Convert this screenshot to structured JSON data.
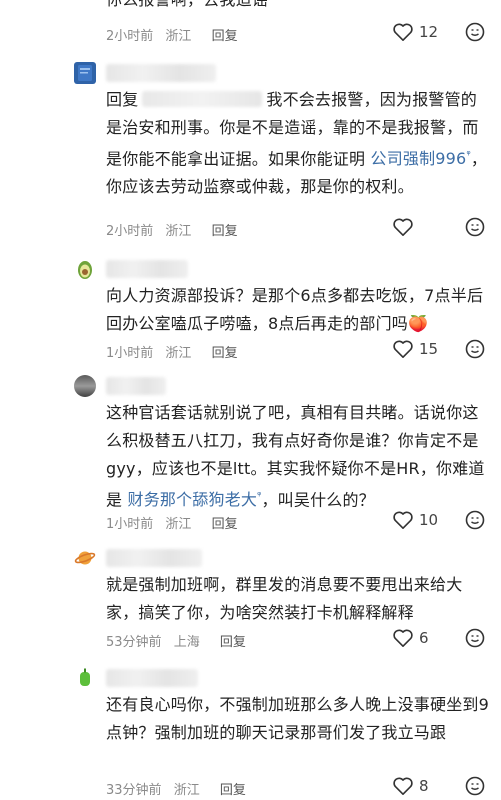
{
  "comments": [
    {
      "text": "你么报警啊，去我造谣",
      "time": "2小时前",
      "location": "浙江",
      "reply": "回复",
      "likes": "12"
    },
    {
      "text_prefix": "回复",
      "text_main": "我不会去报警，因为报警管的是治安和刑事。你是不是造谣，靠的不是我报警，而是你能不能拿出证据。如果你能证明",
      "link": "公司强制996",
      "link_mark": "ᵠ",
      "text_after": "，你应该去劳动监察或仲裁，那是你的权利。",
      "time": "2小时前",
      "location": "浙江",
      "reply": "回复",
      "likes": ""
    },
    {
      "text": "向人力资源部投诉？是那个6点多都去吃饭，7点半后回办公室嗑瓜子唠嗑，8点后再走的部门吗🍑",
      "time": "1小时前",
      "location": "浙江",
      "reply": "回复",
      "likes": "15"
    },
    {
      "text_main": "这种官话套话就别说了吧，真相有目共睹。话说你这么积极替五八扛刀，我有点好奇你是谁？你肯定不是gyy，应该也不是ltt。其实我怀疑你不是HR，你难道是",
      "link": "财务那个舔狗老大",
      "link_mark": "ᵠ",
      "text_after": "，叫吴什么的？",
      "time": "1小时前",
      "location": "浙江",
      "reply": "回复",
      "likes": "10"
    },
    {
      "text": "就是强制加班啊，群里发的消息要不要甩出来给大家，搞笑了你，为啥突然装打卡机解释解释",
      "time": "53分钟前",
      "location": "上海",
      "reply": "回复",
      "likes": "6"
    },
    {
      "text": "还有良心吗你，不强制加班那么多人晚上没事硬坐到9点钟？强制加班的聊天记录那哥们发了我立马跟",
      "time": "33分钟前",
      "location": "浙江",
      "reply": "回复",
      "likes": "8"
    }
  ],
  "icons": {
    "like": "heart-outline-icon",
    "react": "smiley-face-icon",
    "link": "search-link-icon"
  },
  "colors": {
    "link": "#3d6ea6",
    "meta": "#8a8a8a",
    "text": "#222222"
  }
}
